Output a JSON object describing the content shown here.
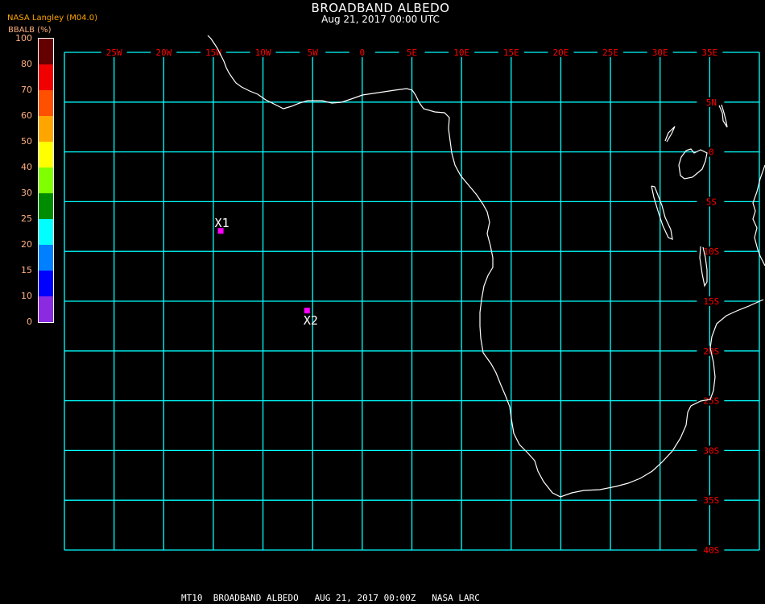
{
  "header": {
    "title": "BROADBAND ALBEDO",
    "subtitle": "Aug 21, 2017 00:00 UTC",
    "source": "NASA Langley (M04.0)"
  },
  "colorbar": {
    "title": "BBALB (%)",
    "segments": [
      {
        "from": 80,
        "to": 100,
        "color": "#650000"
      },
      {
        "from": 70,
        "to": 80,
        "color": "#f00000"
      },
      {
        "from": 60,
        "to": 70,
        "color": "#ff5000"
      },
      {
        "from": 50,
        "to": 60,
        "color": "#ffa500"
      },
      {
        "from": 40,
        "to": 50,
        "color": "#ffff00"
      },
      {
        "from": 30,
        "to": 40,
        "color": "#80ff00"
      },
      {
        "from": 25,
        "to": 30,
        "color": "#008c00"
      },
      {
        "from": 20,
        "to": 25,
        "color": "#00ffff"
      },
      {
        "from": 15,
        "to": 20,
        "color": "#0080ff"
      },
      {
        "from": 10,
        "to": 15,
        "color": "#0000ff"
      },
      {
        "from": 0,
        "to": 10,
        "color": "#8a2be2"
      }
    ],
    "labels": [
      "100",
      "80",
      "70",
      "60",
      "50",
      "40",
      "30",
      "25",
      "20",
      "15",
      "10",
      "0"
    ]
  },
  "map": {
    "lon_labels": [
      "25W",
      "20W",
      "15W",
      "10W",
      "5W",
      "0",
      "5E",
      "10E",
      "15E",
      "20E",
      "25E",
      "30E",
      "35E"
    ],
    "lat_labels": [
      "5N",
      "0",
      "5S",
      "10S",
      "15S",
      "20S",
      "25S",
      "30S",
      "35S",
      "40S"
    ],
    "extent": {
      "lon": [
        -30,
        40
      ],
      "lat": [
        -40,
        10
      ]
    },
    "grid_color": "#00ffff",
    "label_color": "#ff0000",
    "coast_color": "#ffffff",
    "markers": [
      {
        "label": "X1",
        "lon": -14.3,
        "lat": -7.9,
        "color": "#ff00ff"
      },
      {
        "label": "X2",
        "lon": -5.6,
        "lat": -15.9,
        "color": "#ff00ff"
      }
    ]
  },
  "footer": "MT10  BROADBAND ALBEDO   AUG 21, 2017 00:00Z   NASA LARC"
}
